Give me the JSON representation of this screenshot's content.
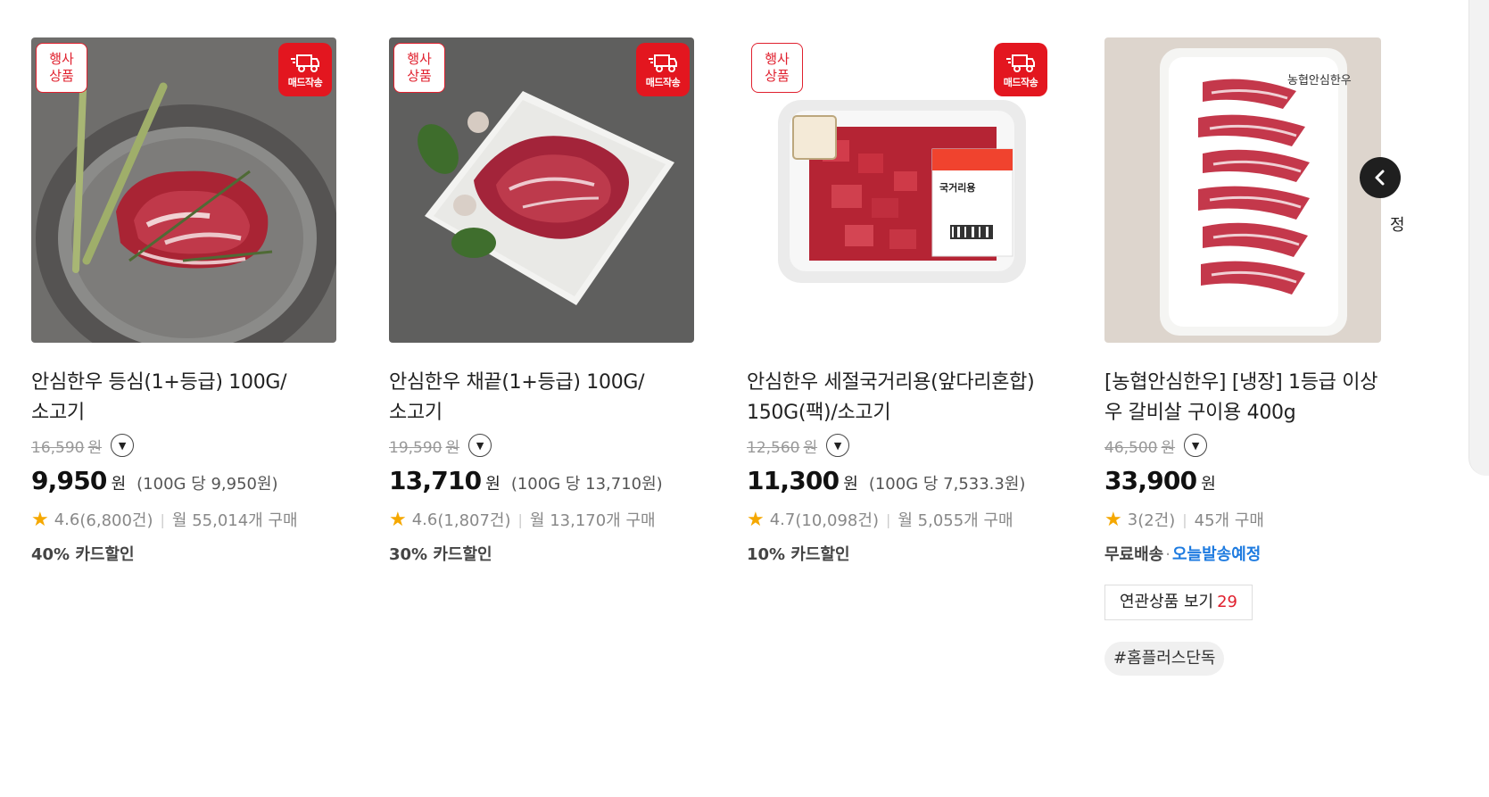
{
  "products": [
    {
      "event_badge": "행사\n상품",
      "delivery_badge": "매드작송",
      "title": "안심한우 등심(1+등급) 100G/소고기",
      "original_price": "16,590",
      "original_unit": "원",
      "price": "9,950",
      "price_unit": "원",
      "unit_price": "(100G 당 9,950원)",
      "rating": "4.6",
      "review_count": "(6,800건)",
      "monthly_purchase": "월 55,014개 구매",
      "card_discount": "40% 카드할인"
    },
    {
      "event_badge": "행사\n상품",
      "delivery_badge": "매드작송",
      "title": "안심한우 채끝(1+등급) 100G/소고기",
      "original_price": "19,590",
      "original_unit": "원",
      "price": "13,710",
      "price_unit": "원",
      "unit_price": "(100G 당 13,710원)",
      "rating": "4.6",
      "review_count": "(1,807건)",
      "monthly_purchase": "월 13,170개 구매",
      "card_discount": "30% 카드할인"
    },
    {
      "event_badge": "행사\n상품",
      "delivery_badge": "매드작송",
      "title": "안심한우 세절국거리용(앞다리혼합) 150G(팩)/소고기",
      "original_price": "12,560",
      "original_unit": "원",
      "price": "11,300",
      "price_unit": "원",
      "unit_price": "(100G 당 7,533.3원)",
      "rating": "4.7",
      "review_count": "(10,098건)",
      "monthly_purchase": "월 5,055개 구매",
      "card_discount": "10% 카드할인",
      "package_label": "국거리용"
    },
    {
      "title": "[농협안심한우] [냉장] 1등급 이상 우 갈비살 구이용 400g",
      "original_price": "46,500",
      "original_unit": "원",
      "price": "33,900",
      "price_unit": "원",
      "rating": "3",
      "review_count": "(2건)",
      "monthly_purchase": "45개 구매",
      "free_shipping": "무료배송",
      "today_shipping": "오늘발송예정",
      "related_label": "연관상품 보기",
      "related_count": "29",
      "tag": "#홈플러스단독",
      "brand_watermark": "농협안심한우"
    }
  ],
  "side": {
    "char": "정",
    "prev_icon": "chevron-left-icon"
  },
  "colors": {
    "accent_red": "#e3161f",
    "star": "#f5a800",
    "ship_blue": "#1e7be0"
  }
}
